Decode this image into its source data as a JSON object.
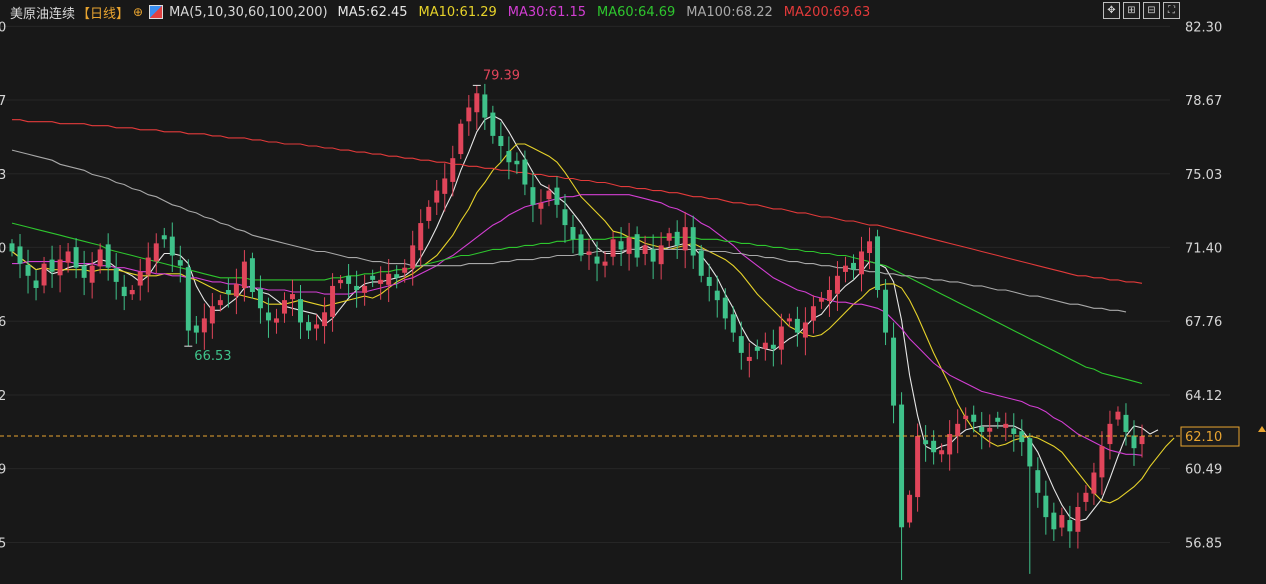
{
  "header": {
    "title": "美原油连续",
    "period": "【日线】",
    "ma_def": "MA(5,10,30,60,100,200)",
    "ma_values": [
      {
        "label": "MA5:62.45",
        "color": "#e6e6e6"
      },
      {
        "label": "MA10:61.29",
        "color": "#e6d22a"
      },
      {
        "label": "MA30:61.15",
        "color": "#d23ed2"
      },
      {
        "label": "MA60:64.69",
        "color": "#2ec62e"
      },
      {
        "label": "MA100:68.22",
        "color": "#a8a8a8"
      },
      {
        "label": "MA200:69.63",
        "color": "#e23a3a"
      }
    ]
  },
  "toolbar": {
    "buttons": [
      "move-icon",
      "zoom-in-icon",
      "zoom-out-icon",
      "fullscreen-icon"
    ]
  },
  "price_label": "62.10",
  "chart_data": {
    "type": "candlestick",
    "ylim": [
      55.0,
      83.6
    ],
    "y_ticks": [
      "82.30",
      "78.67",
      "75.03",
      "71.40",
      "67.76",
      "64.12",
      "60.49",
      "56.85"
    ],
    "left_tick_fragments": [
      "0",
      "7",
      "3",
      "0",
      "6",
      "2",
      "9",
      "5"
    ],
    "last_price": 62.1,
    "annotations": [
      {
        "label": "79.39",
        "value": 79.39,
        "index": 58
      },
      {
        "label": "66.53",
        "value": 66.53,
        "index": 22
      }
    ],
    "colors": {
      "up": "#e0455a",
      "down": "#3fc28a"
    },
    "close": [
      71.2,
      70.6,
      70.0,
      69.4,
      70.6,
      70.2,
      70.8,
      71.2,
      70.4,
      69.9,
      70.5,
      71.3,
      70.4,
      69.7,
      69.0,
      69.3,
      70.2,
      70.9,
      71.6,
      71.8,
      71.0,
      70.5,
      67.3,
      67.2,
      67.9,
      68.5,
      68.8,
      69.1,
      69.6,
      70.7,
      69.2,
      68.4,
      67.8,
      67.9,
      68.8,
      69.1,
      67.7,
      67.3,
      67.6,
      68.2,
      69.5,
      69.8,
      69.6,
      69.3,
      69.5,
      69.8,
      69.8,
      70.1,
      69.9,
      70.4,
      71.5,
      72.6,
      73.4,
      74.2,
      74.8,
      75.8,
      77.5,
      78.3,
      79.0,
      77.8,
      76.9,
      76.4,
      75.6,
      75.5,
      74.5,
      73.5,
      73.6,
      74.2,
      73.5,
      72.5,
      71.8,
      71.0,
      71.2,
      70.6,
      70.7,
      71.8,
      71.3,
      71.9,
      70.9,
      71.5,
      70.7,
      71.5,
      72.1,
      71.5,
      72.4,
      71.0,
      70.0,
      69.5,
      68.8,
      67.9,
      67.2,
      66.2,
      66.0,
      66.3,
      66.7,
      66.4,
      67.5,
      67.9,
      67.2,
      67.7,
      68.5,
      68.9,
      69.3,
      70.0,
      70.5,
      70.3,
      71.2,
      71.7,
      69.3,
      67.2,
      63.6,
      57.6,
      59.2,
      62.1,
      61.7,
      61.3,
      61.4,
      62.2,
      62.7,
      63.1,
      62.8,
      62.3,
      62.5,
      62.8,
      62.7,
      62.2,
      61.8,
      60.6,
      59.3,
      58.1,
      57.5,
      58.2,
      57.4,
      58.6,
      59.3,
      60.3,
      61.6,
      62.7,
      63.3,
      62.3,
      61.5,
      62.1
    ],
    "ma_series": [
      {
        "name": "MA5",
        "color": "#e6e6e6",
        "values": [
          71.2,
          70.9,
          70.6,
          70.3,
          70.4,
          70.1,
          70.2,
          70.4,
          70.5,
          70.5,
          70.6,
          70.8,
          70.7,
          70.4,
          70.2,
          70.0,
          69.7,
          70.0,
          70.6,
          71.1,
          71.1,
          71.0,
          70.6,
          69.5,
          68.8,
          68.3,
          68.3,
          68.6,
          68.9,
          69.4,
          69.5,
          69.2,
          69.1,
          68.8,
          68.5,
          68.4,
          68.3,
          68.2,
          68.1,
          67.6,
          67.9,
          68.4,
          68.9,
          69.3,
          69.6,
          69.7,
          69.7,
          69.8,
          69.9,
          70.0,
          70.3,
          70.9,
          71.6,
          72.4,
          73.3,
          74.1,
          75.2,
          76.1,
          77.1,
          77.7,
          77.9,
          77.7,
          77.1,
          76.4,
          75.8,
          75.1,
          74.5,
          74.3,
          73.9,
          73.6,
          73.1,
          72.6,
          72.0,
          71.4,
          71.1,
          71.1,
          71.1,
          71.3,
          71.3,
          71.5,
          71.3,
          71.3,
          71.4,
          71.5,
          71.6,
          71.4,
          71.0,
          70.5,
          69.9,
          69.1,
          68.4,
          67.5,
          66.8,
          66.5,
          66.4,
          66.3,
          66.6,
          66.9,
          67.1,
          67.5,
          67.9,
          68.1,
          68.6,
          69.1,
          69.5,
          69.8,
          70.2,
          70.7,
          70.6,
          70.4,
          69.7,
          67.8,
          65.1,
          63.1,
          61.6,
          61.4,
          61.6,
          61.7,
          62.1,
          62.4,
          62.5,
          62.6,
          62.6,
          62.6,
          62.6,
          62.6,
          62.4,
          61.9,
          61.3,
          60.4,
          59.5,
          58.7,
          58.1,
          57.9,
          58.0,
          58.5,
          59.0,
          60.0,
          61.1,
          62.1,
          62.6,
          62.5,
          62.2,
          62.4
        ]
      },
      {
        "name": "MA10",
        "color": "#e6d22a",
        "values": [
          71.2,
          70.9,
          70.6,
          70.3,
          70.4,
          70.3,
          70.3,
          70.3,
          70.3,
          70.3,
          70.2,
          70.3,
          70.3,
          70.3,
          70.2,
          70.1,
          70.0,
          70.0,
          70.0,
          70.1,
          70.1,
          70.1,
          69.9,
          69.8,
          69.6,
          69.4,
          69.2,
          69.1,
          69.1,
          69.0,
          68.9,
          68.8,
          68.6,
          68.6,
          68.6,
          68.7,
          68.8,
          68.7,
          68.6,
          68.5,
          68.6,
          68.7,
          68.8,
          68.9,
          69.0,
          68.9,
          69.1,
          69.4,
          69.7,
          69.9,
          70.1,
          70.4,
          70.7,
          71.0,
          71.5,
          72.0,
          72.7,
          73.3,
          74.1,
          74.6,
          75.2,
          75.6,
          76.1,
          76.5,
          76.5,
          76.3,
          76.1,
          75.9,
          75.6,
          75.1,
          74.5,
          73.9,
          73.5,
          73.1,
          72.7,
          72.2,
          72.1,
          71.9,
          71.8,
          71.6,
          71.5,
          71.4,
          71.3,
          71.4,
          71.5,
          71.6,
          71.4,
          71.2,
          71.0,
          70.8,
          70.5,
          70.1,
          69.6,
          69.1,
          68.7,
          68.3,
          67.9,
          67.5,
          67.3,
          67.1,
          67.0,
          67.1,
          67.4,
          67.8,
          68.2,
          68.6,
          68.9,
          69.3,
          69.5,
          69.6,
          69.6,
          69.4,
          68.8,
          68.0,
          67.1,
          66.2,
          65.4,
          64.6,
          63.7,
          63.0,
          62.4,
          62.1,
          61.8,
          61.6,
          61.7,
          61.9,
          62.0,
          62.1,
          62.0,
          61.8,
          61.6,
          61.3,
          60.8,
          60.3,
          59.8,
          59.3,
          58.9,
          58.8,
          59.0,
          59.3,
          59.6,
          60.0,
          60.6,
          61.1,
          61.6,
          62.0
        ]
      },
      {
        "name": "MA30",
        "color": "#d23ed2",
        "values": [
          70.6,
          70.6,
          70.7,
          70.7,
          70.7,
          70.7,
          70.7,
          70.7,
          70.6,
          70.6,
          70.6,
          70.5,
          70.5,
          70.4,
          70.4,
          70.3,
          70.2,
          70.2,
          70.1,
          70.1,
          70.0,
          70.0,
          69.9,
          69.9,
          69.8,
          69.7,
          69.7,
          69.6,
          69.6,
          69.5,
          69.4,
          69.4,
          69.3,
          69.3,
          69.3,
          69.2,
          69.2,
          69.2,
          69.2,
          69.1,
          69.1,
          69.1,
          69.1,
          69.2,
          69.2,
          69.3,
          69.4,
          69.5,
          69.6,
          69.8,
          69.9,
          70.1,
          70.3,
          70.5,
          70.8,
          71.0,
          71.3,
          71.6,
          71.9,
          72.2,
          72.5,
          72.7,
          73.0,
          73.2,
          73.4,
          73.5,
          73.6,
          73.7,
          73.8,
          73.9,
          73.9,
          74.0,
          74.0,
          74.0,
          74.0,
          74.0,
          74.0,
          74.0,
          73.9,
          73.8,
          73.7,
          73.6,
          73.4,
          73.3,
          73.1,
          72.9,
          72.6,
          72.4,
          72.1,
          71.8,
          71.5,
          71.1,
          70.8,
          70.5,
          70.2,
          69.9,
          69.7,
          69.5,
          69.3,
          69.2,
          69.0,
          68.9,
          68.8,
          68.7,
          68.7,
          68.6,
          68.6,
          68.5,
          68.4,
          68.2,
          67.8,
          67.4,
          66.9,
          66.5,
          66.1,
          65.7,
          65.4,
          65.1,
          64.9,
          64.7,
          64.5,
          64.3,
          64.2,
          64.1,
          64.0,
          63.9,
          63.8,
          63.6,
          63.5,
          63.3,
          63.0,
          62.8,
          62.5,
          62.2,
          62.0,
          61.8,
          61.6,
          61.4,
          61.3,
          61.2,
          61.2,
          61.15
        ]
      },
      {
        "name": "MA60",
        "color": "#2ec62e",
        "values": [
          72.6,
          72.5,
          72.4,
          72.3,
          72.2,
          72.1,
          72.0,
          71.9,
          71.8,
          71.7,
          71.6,
          71.5,
          71.3,
          71.2,
          71.1,
          71.0,
          70.9,
          70.8,
          70.7,
          70.6,
          70.5,
          70.4,
          70.3,
          70.2,
          70.1,
          70.0,
          69.9,
          69.9,
          69.9,
          69.9,
          69.8,
          69.8,
          69.8,
          69.8,
          69.8,
          69.8,
          69.8,
          69.8,
          69.8,
          69.8,
          69.9,
          69.9,
          70.0,
          70.0,
          70.1,
          70.1,
          70.2,
          70.2,
          70.3,
          70.3,
          70.4,
          70.5,
          70.6,
          70.7,
          70.8,
          70.9,
          71.0,
          71.0,
          71.1,
          71.2,
          71.3,
          71.3,
          71.4,
          71.4,
          71.5,
          71.5,
          71.6,
          71.6,
          71.7,
          71.7,
          71.8,
          71.8,
          71.8,
          71.8,
          71.8,
          71.9,
          71.9,
          71.9,
          71.9,
          71.9,
          71.9,
          71.9,
          71.9,
          71.9,
          71.9,
          71.9,
          71.8,
          71.8,
          71.8,
          71.7,
          71.7,
          71.6,
          71.6,
          71.5,
          71.5,
          71.4,
          71.4,
          71.3,
          71.3,
          71.2,
          71.2,
          71.1,
          71.1,
          71.0,
          71.0,
          70.9,
          70.8,
          70.7,
          70.6,
          70.5,
          70.3,
          70.1,
          69.9,
          69.7,
          69.5,
          69.3,
          69.1,
          68.9,
          68.7,
          68.5,
          68.3,
          68.1,
          67.9,
          67.7,
          67.5,
          67.3,
          67.1,
          66.9,
          66.7,
          66.5,
          66.3,
          66.1,
          65.9,
          65.7,
          65.5,
          65.4,
          65.2,
          65.1,
          65.0,
          64.9,
          64.8,
          64.69
        ]
      },
      {
        "name": "MA100",
        "color": "#a8a8a8",
        "values": [
          76.2,
          76.1,
          76.0,
          75.9,
          75.8,
          75.7,
          75.5,
          75.4,
          75.3,
          75.2,
          75.0,
          74.9,
          74.8,
          74.6,
          74.5,
          74.3,
          74.2,
          74.0,
          73.9,
          73.7,
          73.5,
          73.4,
          73.2,
          73.1,
          72.9,
          72.8,
          72.6,
          72.5,
          72.3,
          72.2,
          72.0,
          71.9,
          71.8,
          71.7,
          71.6,
          71.5,
          71.4,
          71.3,
          71.2,
          71.2,
          71.1,
          71.0,
          70.9,
          70.9,
          70.8,
          70.7,
          70.7,
          70.6,
          70.6,
          70.6,
          70.5,
          70.5,
          70.5,
          70.5,
          70.5,
          70.5,
          70.5,
          70.6,
          70.6,
          70.6,
          70.6,
          70.7,
          70.7,
          70.8,
          70.8,
          70.8,
          70.9,
          70.9,
          71.0,
          71.0,
          71.0,
          71.1,
          71.1,
          71.2,
          71.2,
          71.2,
          71.2,
          71.3,
          71.3,
          71.3,
          71.3,
          71.3,
          71.3,
          71.3,
          71.3,
          71.3,
          71.3,
          71.2,
          71.2,
          71.2,
          71.1,
          71.1,
          71.0,
          71.0,
          70.9,
          70.9,
          70.8,
          70.7,
          70.7,
          70.6,
          70.6,
          70.5,
          70.5,
          70.4,
          70.4,
          70.3,
          70.3,
          70.2,
          70.2,
          70.1,
          70.1,
          70.0,
          70.0,
          69.9,
          69.9,
          69.8,
          69.8,
          69.7,
          69.7,
          69.6,
          69.5,
          69.5,
          69.4,
          69.3,
          69.3,
          69.2,
          69.1,
          69.0,
          69.0,
          68.9,
          68.8,
          68.7,
          68.6,
          68.6,
          68.5,
          68.4,
          68.4,
          68.3,
          68.3,
          68.22
        ]
      },
      {
        "name": "MA200",
        "color": "#e23a3a",
        "values": [
          77.7,
          77.7,
          77.6,
          77.6,
          77.6,
          77.6,
          77.5,
          77.5,
          77.5,
          77.5,
          77.4,
          77.4,
          77.4,
          77.3,
          77.3,
          77.3,
          77.2,
          77.2,
          77.2,
          77.1,
          77.1,
          77.1,
          77.0,
          77.0,
          77.0,
          76.9,
          76.9,
          76.8,
          76.8,
          76.8,
          76.7,
          76.7,
          76.6,
          76.6,
          76.5,
          76.5,
          76.5,
          76.4,
          76.4,
          76.3,
          76.3,
          76.2,
          76.2,
          76.1,
          76.1,
          76.0,
          76.0,
          75.9,
          75.9,
          75.8,
          75.8,
          75.7,
          75.7,
          75.6,
          75.6,
          75.5,
          75.5,
          75.4,
          75.4,
          75.3,
          75.3,
          75.2,
          75.2,
          75.1,
          75.1,
          75.0,
          75.0,
          74.9,
          74.9,
          74.8,
          74.8,
          74.7,
          74.7,
          74.6,
          74.6,
          74.5,
          74.4,
          74.4,
          74.3,
          74.3,
          74.2,
          74.2,
          74.1,
          74.1,
          74.0,
          73.9,
          73.9,
          73.8,
          73.8,
          73.7,
          73.6,
          73.6,
          73.5,
          73.5,
          73.4,
          73.3,
          73.3,
          73.2,
          73.1,
          73.1,
          73.0,
          72.9,
          72.9,
          72.8,
          72.7,
          72.7,
          72.6,
          72.5,
          72.5,
          72.4,
          72.3,
          72.2,
          72.1,
          72.0,
          71.9,
          71.8,
          71.7,
          71.6,
          71.5,
          71.4,
          71.3,
          71.2,
          71.1,
          71.0,
          70.9,
          70.8,
          70.7,
          70.6,
          70.5,
          70.4,
          70.3,
          70.2,
          70.1,
          70.0,
          70.0,
          69.9,
          69.9,
          69.8,
          69.8,
          69.7,
          69.7,
          69.63
        ]
      }
    ]
  }
}
